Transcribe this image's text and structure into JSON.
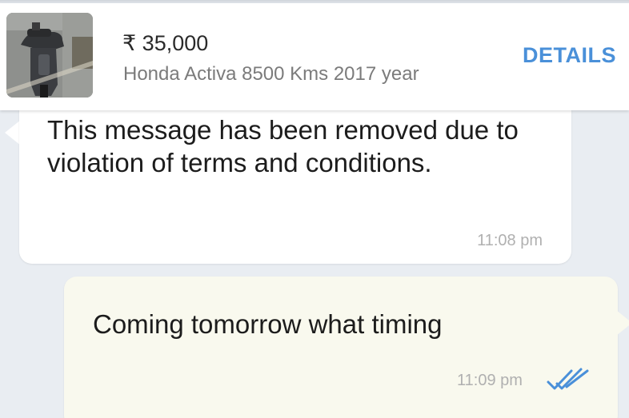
{
  "listing": {
    "price": "₹ 35,000",
    "subtitle": "Honda Activa 8500 Kms 2017 year",
    "details_label": "DETAILS",
    "thumbnail_icon": "scooter-photo"
  },
  "messages": [
    {
      "direction": "incoming",
      "text": "This message has been removed due to violation of terms and conditions.",
      "time": "11:08 pm"
    },
    {
      "direction": "outgoing",
      "text": "Coming tomorrow what timing",
      "time": "11:09 pm",
      "status_icon": "double-check-icon"
    }
  ],
  "colors": {
    "accent": "#4a90d9",
    "chat_background": "#e9edf2",
    "outgoing_bubble": "#f9f9ee",
    "incoming_bubble": "#ffffff"
  }
}
